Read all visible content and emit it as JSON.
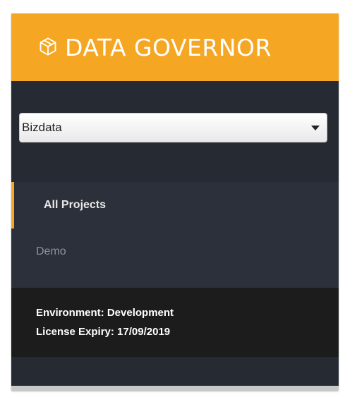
{
  "brand": {
    "title": "DATA GOVERNOR",
    "icon": "cube-icon",
    "color": "#f5a623"
  },
  "project_selector": {
    "selected": "Bizdata"
  },
  "nav": {
    "items": [
      {
        "label": "All Projects",
        "active": true
      },
      {
        "label": "Demo",
        "active": false
      }
    ]
  },
  "environment": {
    "environment_line": "Environment: Development",
    "license_line": "License Expiry: 17/09/2019"
  }
}
